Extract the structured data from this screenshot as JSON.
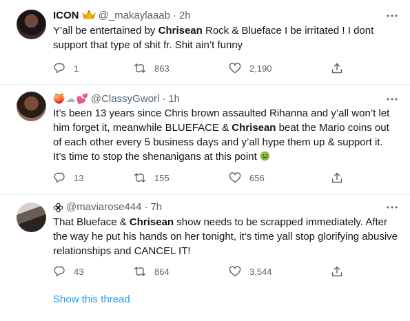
{
  "tweets": [
    {
      "name": "ICON",
      "name_emoji": "crown-icon",
      "handle": "@_makaylaaab",
      "time": "2h",
      "text_parts": [
        "Y’all be entertained by ",
        "Chrisean",
        " Rock & Blueface I be irritated ! I dont support that type of shit fr. Shit ain’t funny"
      ],
      "replies": "1",
      "retweets": "863",
      "likes": "2,190"
    },
    {
      "name_emojis": [
        "🍑",
        "☁",
        "💕"
      ],
      "handle": "@ClassyGworl",
      "time": "1h",
      "text_parts": [
        "It’s been 13 years since Chris brown assaulted Rihanna and y’all won’t let him forget it, meanwhile BLUEFACE & ",
        "Chrisean",
        " beat the Mario coins out of each other every 5 business days and y’all hype them up & support it. It’s time to stop the shenanigans at this point "
      ],
      "text_emoji": "nauseated-face-icon",
      "replies": "13",
      "retweets": "155",
      "likes": "656"
    },
    {
      "name_icon": "flower-icon",
      "handle": "@maviarose444",
      "time": "7h",
      "text_parts": [
        "That Blueface & ",
        "Chrisean",
        " show needs to be scrapped immediately. After the way he put his hands on her tonight, it’s time yall stop glorifying abusive relationships and CANCEL IT!"
      ],
      "replies": "43",
      "retweets": "864",
      "likes": "3,544"
    }
  ],
  "show_thread": "Show this thread",
  "colors": {
    "link": "#1d9bf0",
    "secondary_text": "#536471",
    "divider": "#e6ecf0"
  }
}
